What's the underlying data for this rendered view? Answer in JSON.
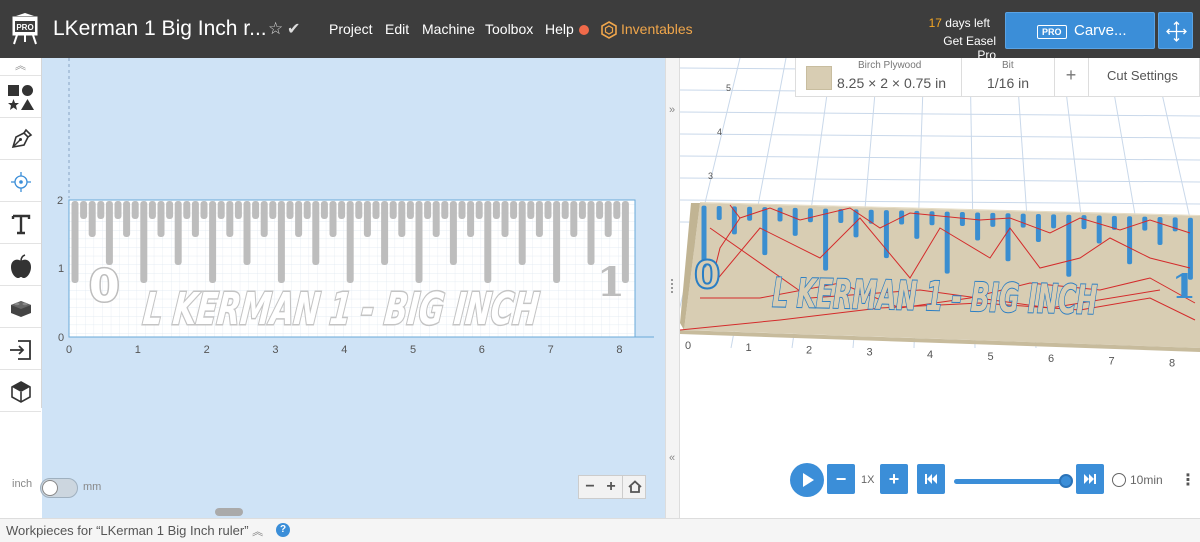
{
  "header": {
    "doc_title": "LKerman 1 Big Inch r...",
    "menu": [
      "Project",
      "Edit",
      "Machine",
      "Toolbox",
      "Help"
    ],
    "inventables_label": "Inventables",
    "trial_days": "17",
    "trial_suffix": " days left",
    "get_pro": "Get Easel Pro",
    "logo_badge": "PRO",
    "carve_badge": "PRO",
    "carve_label": "Carve...",
    "accent_color": "#3b8ed8",
    "inventables_color": "#f0a64b"
  },
  "toolbar": {
    "tools": [
      "shapes-icon",
      "pen-icon",
      "target-icon",
      "text-icon",
      "apple-icon",
      "lego-icon",
      "import-icon",
      "cube-icon"
    ]
  },
  "design": {
    "workpiece_text": "L KERMAN 1 - BIG INCH",
    "num_left": "0",
    "num_right": "1",
    "x_ticks": [
      "0",
      "1",
      "2",
      "3",
      "4",
      "5",
      "6",
      "7",
      "8"
    ],
    "y_ticks": [
      "2",
      "1",
      "0"
    ],
    "unit_inch": "inch",
    "unit_mm": "mm",
    "zoom_out": "−",
    "zoom_in": "+"
  },
  "preview": {
    "material_name": "Birch Plywood",
    "material_dims": "8.25 × 2 × 0.75 in",
    "bit_label": "Bit",
    "bit_value": "1/16 in",
    "add_label": "+",
    "cut_settings": "Cut Settings",
    "axis_x": [
      "0",
      "1",
      "2",
      "3",
      "4",
      "5",
      "6",
      "7",
      "8"
    ],
    "axis_y": [
      "3",
      "4",
      "5"
    ],
    "piece_text": "L KERMAN 1 - BIG INCH",
    "piece_num_left": "0",
    "piece_num_right": "1"
  },
  "player": {
    "minus": "−",
    "speed": "1X",
    "plus": "+",
    "time": "10min",
    "progress": 1.0
  },
  "footer": {
    "workpieces": "Workpieces for “LKerman 1 Big Inch ruler”",
    "help": "?"
  }
}
